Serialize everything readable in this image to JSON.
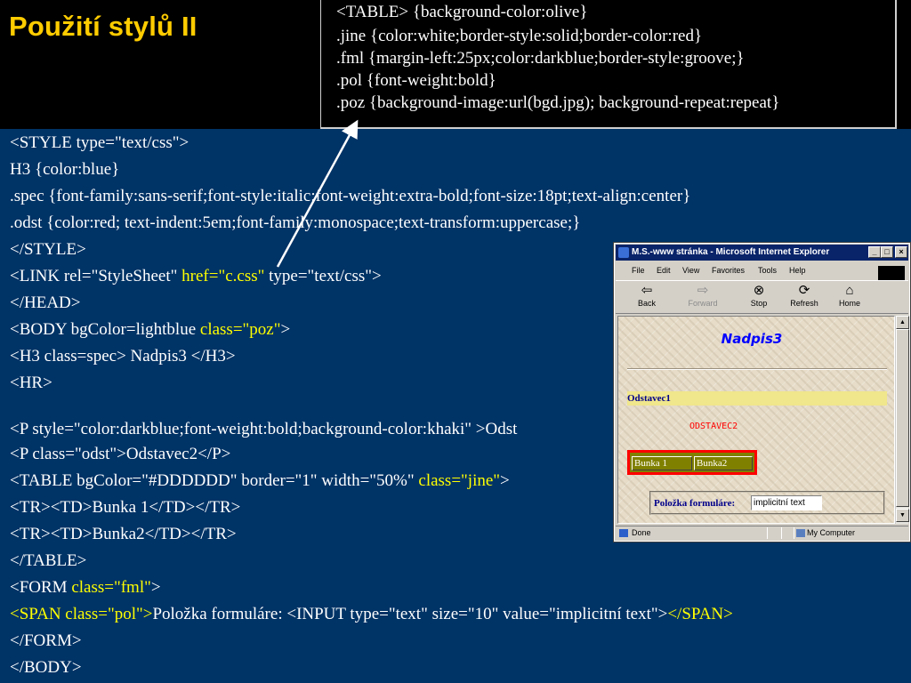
{
  "slide": {
    "title": "Použití stylů II",
    "css_box": [
      "<TABLE> {background-color:olive}",
      ".jine {color:white;border-style:solid;border-color:red}",
      ".fml {margin-left:25px;color:darkblue;border-style:groove;}",
      ".pol {font-weight:bold}",
      ".poz {background-image:url(bgd.jpg); background-repeat:repeat}"
    ],
    "code": [
      {
        "parts": [
          {
            "t": "<STYLE type=\"text/css\">"
          }
        ]
      },
      {
        "parts": [
          {
            "t": "H3 {color:blue}"
          }
        ]
      },
      {
        "parts": [
          {
            "t": ".spec {font-family:sans-serif;font-style:italic;font-weight:extra-bold;font-size:18pt;text-align:center}"
          }
        ]
      },
      {
        "parts": [
          {
            "t": ".odst {color:red; text-indent:5em;font-family:monospace;text-transform:uppercase;}"
          }
        ]
      },
      {
        "parts": [
          {
            "t": "</STYLE>"
          }
        ]
      },
      {
        "parts": [
          {
            "t": "<LINK rel=\"StyleSheet\" "
          },
          {
            "t": "href=\"c.css\"",
            "hl": true
          },
          {
            "t": " type=\"text/css\">"
          }
        ]
      },
      {
        "parts": [
          {
            "t": "</HEAD>"
          }
        ]
      },
      {
        "parts": [
          {
            "t": "<BODY bgColor=lightblue "
          },
          {
            "t": "class=\"poz\"",
            "hl": true
          },
          {
            "t": ">"
          }
        ]
      },
      {
        "parts": [
          {
            "t": "<H3 class=spec> Nadpis3 </H3>"
          }
        ]
      },
      {
        "parts": [
          {
            "t": "<HR>"
          }
        ]
      },
      {
        "parts": [
          {
            "t": "<P style=\"color:darkblue;font-weight:bold;background-color:khaki\" >Odst"
          }
        ]
      },
      {
        "parts": [
          {
            "t": "<P class=\"odst\">Odstavec2</P>"
          }
        ]
      },
      {
        "parts": [
          {
            "t": "<TABLE bgColor=\"#DDDDDD\" border=\"1\" width=\"50%\" "
          },
          {
            "t": "class=\"jine\"",
            "hl": true
          },
          {
            "t": ">"
          }
        ]
      },
      {
        "parts": [
          {
            "t": "<TR><TD>Bunka 1</TD></TR>"
          }
        ]
      },
      {
        "parts": [
          {
            "t": "<TR><TD>Bunka2</TD></TR>"
          }
        ]
      },
      {
        "parts": [
          {
            "t": "</TABLE>"
          }
        ]
      },
      {
        "parts": [
          {
            "t": "<FORM "
          },
          {
            "t": "class=\"fml\"",
            "hl": true
          },
          {
            "t": ">"
          }
        ]
      },
      {
        "parts": [
          {
            "t": "<SPAN class=\"pol\">",
            "hl": true
          },
          {
            "t": "Položka formuláre: <INPUT type=\"text\" size=\"10\" value=\"implicitní text\">"
          },
          {
            "t": "</SPAN>",
            "hl": true
          }
        ]
      },
      {
        "parts": [
          {
            "t": "</FORM>"
          }
        ]
      },
      {
        "parts": [
          {
            "t": "</BODY>"
          }
        ]
      }
    ]
  },
  "browser": {
    "title": "M.S.-www stránka - Microsoft Internet Explorer",
    "window_buttons": [
      "_",
      "□",
      "×"
    ],
    "menu": [
      "File",
      "Edit",
      "View",
      "Favorites",
      "Tools",
      "Help"
    ],
    "toolbar": [
      {
        "label": "Back",
        "icon": "back-arrow-icon",
        "glyph": "⇦",
        "disabled": false
      },
      {
        "label": "Forward",
        "icon": "forward-arrow-icon",
        "glyph": "⇨",
        "disabled": true
      },
      {
        "label": "Stop",
        "icon": "stop-icon",
        "glyph": "⊗",
        "disabled": false
      },
      {
        "label": "Refresh",
        "icon": "refresh-icon",
        "glyph": "⟳",
        "disabled": false
      },
      {
        "label": "Home",
        "icon": "home-icon",
        "glyph": "⌂",
        "disabled": false
      }
    ],
    "page": {
      "heading": "Nadpis3",
      "para1": "Odstavec1",
      "para2": "ODSTAVEC2",
      "table_cells": [
        "Bunka 1",
        "Bunka2"
      ],
      "form_label": "Položka formuláre:",
      "form_value": "implicitní text"
    },
    "status": {
      "text": "Done",
      "zone": "My Computer"
    }
  },
  "colors": {
    "slide_bg": "#003366",
    "title": "#FFCC00",
    "highlight": "#FFFF00",
    "ie_titlebar": "#0A246A"
  }
}
